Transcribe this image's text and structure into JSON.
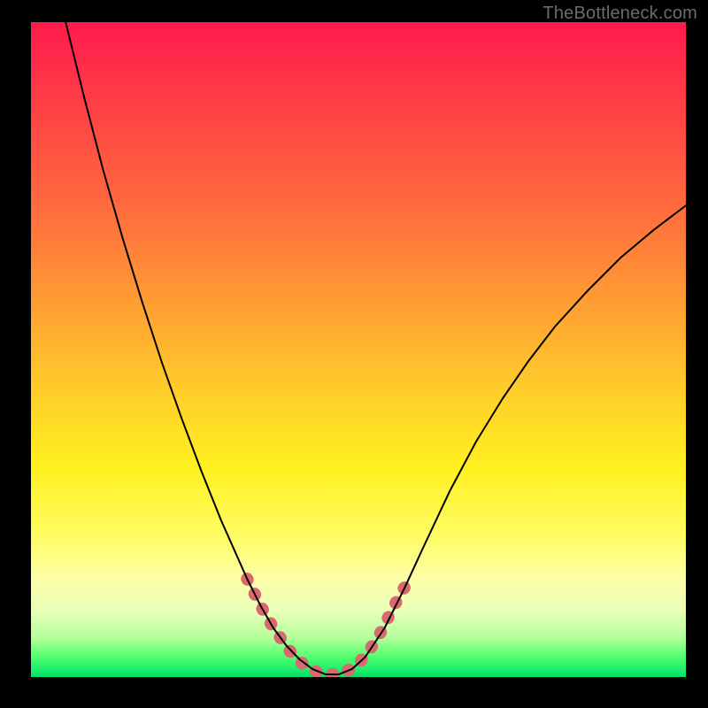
{
  "watermark": {
    "text": "TheBottleneck.com"
  },
  "chart_data": {
    "type": "line",
    "title": "",
    "xlabel": "",
    "ylabel": "",
    "xlim": [
      0,
      1
    ],
    "ylim": [
      0,
      1
    ],
    "background_gradient_stops": [
      {
        "pos": 0.0,
        "color": "#ff1a4d"
      },
      {
        "pos": 0.1,
        "color": "#ff3847"
      },
      {
        "pos": 0.28,
        "color": "#ff6a3e"
      },
      {
        "pos": 0.42,
        "color": "#ff9a34"
      },
      {
        "pos": 0.55,
        "color": "#ffc92a"
      },
      {
        "pos": 0.68,
        "color": "#fff020"
      },
      {
        "pos": 0.78,
        "color": "#fffc60"
      },
      {
        "pos": 0.85,
        "color": "#fdffa8"
      },
      {
        "pos": 0.9,
        "color": "#e8ffb8"
      },
      {
        "pos": 0.94,
        "color": "#b4ff9a"
      },
      {
        "pos": 0.97,
        "color": "#4eff6e"
      },
      {
        "pos": 1.0,
        "color": "#00e36a"
      }
    ],
    "series": [
      {
        "name": "bottleneck-curve",
        "stroke": "#000000",
        "stroke_width": 2,
        "x": [
          0.053,
          0.08,
          0.11,
          0.14,
          0.17,
          0.2,
          0.23,
          0.26,
          0.29,
          0.31,
          0.33,
          0.35,
          0.37,
          0.39,
          0.41,
          0.43,
          0.45,
          0.47,
          0.49,
          0.51,
          0.54,
          0.57,
          0.6,
          0.64,
          0.68,
          0.72,
          0.76,
          0.8,
          0.85,
          0.9,
          0.95,
          1.0
        ],
        "y": [
          1.0,
          0.89,
          0.775,
          0.67,
          0.572,
          0.48,
          0.395,
          0.315,
          0.24,
          0.195,
          0.15,
          0.11,
          0.075,
          0.048,
          0.027,
          0.012,
          0.004,
          0.004,
          0.012,
          0.03,
          0.075,
          0.135,
          0.2,
          0.285,
          0.36,
          0.425,
          0.483,
          0.535,
          0.59,
          0.64,
          0.682,
          0.72
        ]
      }
    ],
    "highlight": {
      "name": "minimum-band",
      "stroke": "#d86a6f",
      "stroke_width": 14,
      "points_x": [
        0.33,
        0.35,
        0.37,
        0.395,
        0.42,
        0.445,
        0.47,
        0.495,
        0.515,
        0.535,
        0.555,
        0.575
      ],
      "points_y": [
        0.15,
        0.11,
        0.075,
        0.04,
        0.015,
        0.004,
        0.004,
        0.015,
        0.038,
        0.07,
        0.11,
        0.145
      ]
    }
  }
}
